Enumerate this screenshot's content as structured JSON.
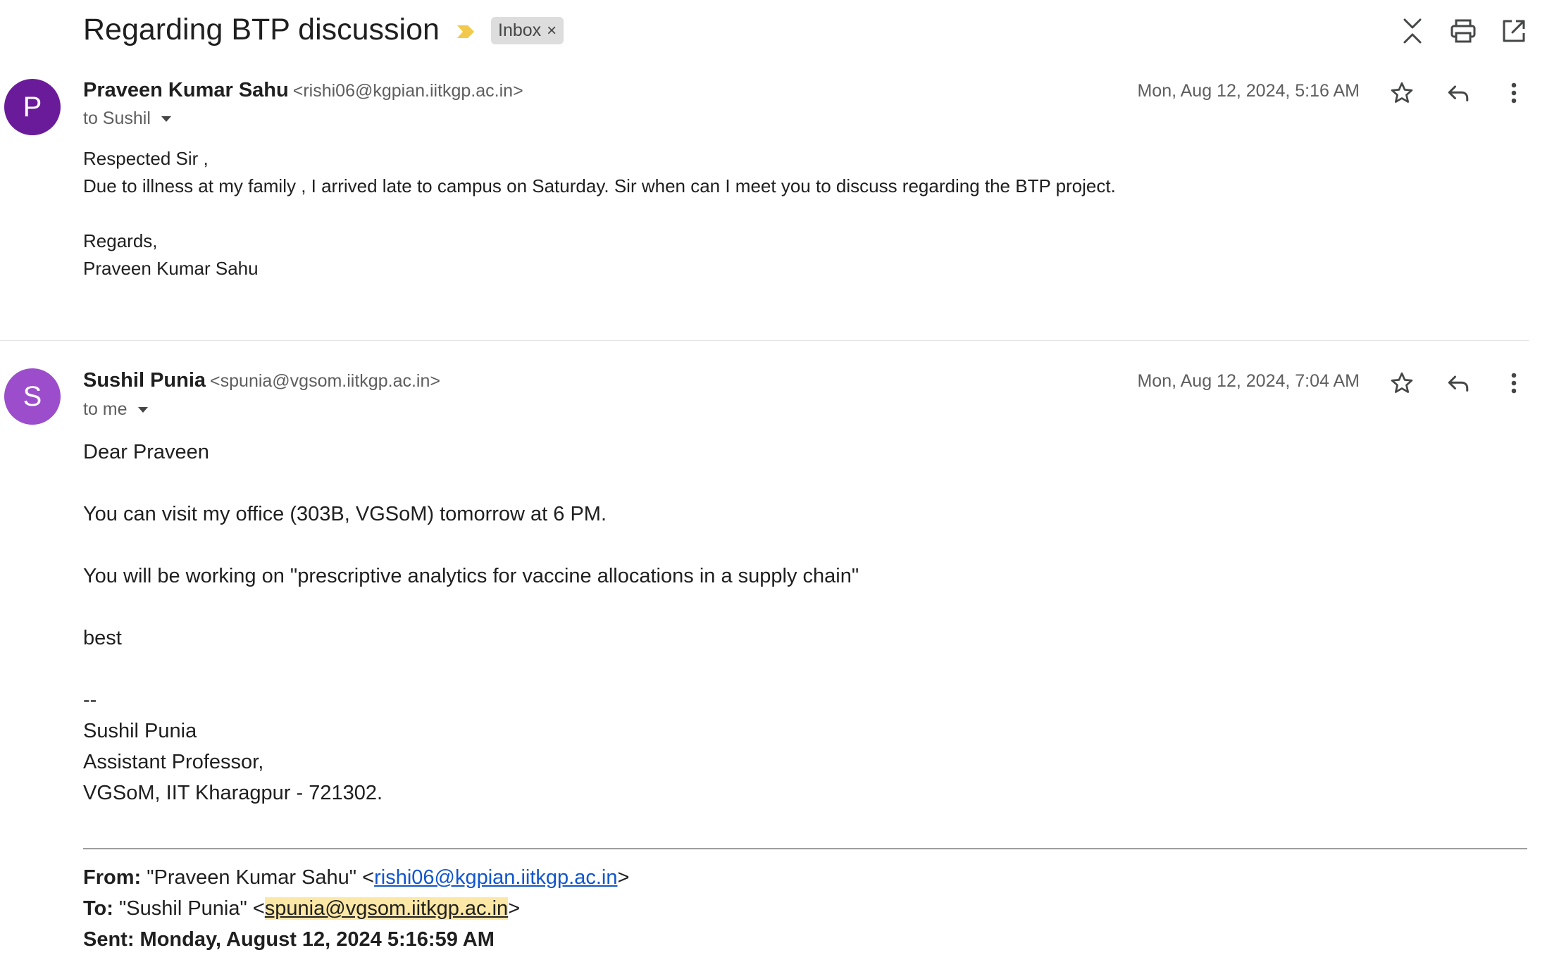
{
  "thread": {
    "subject": "Regarding BTP discussion",
    "label": "Inbox",
    "label_remove": "×"
  },
  "toolbar": {
    "icons": [
      "collapse-all-icon",
      "print-icon",
      "open-in-new-window-icon"
    ]
  },
  "messages": [
    {
      "avatar_letter": "P",
      "avatar_color": "#6a1b9a",
      "sender_name": "Praveen Kumar Sahu",
      "sender_email": "<rishi06@kgpian.iitkgp.ac.in>",
      "recipients": "to Sushil",
      "date": "Mon, Aug 12, 2024, 5:16 AM",
      "body": [
        "Respected Sir ,",
        "Due to illness at my family , I arrived late to campus on Saturday. Sir when can I meet you to discuss regarding the BTP project.",
        "",
        "Regards,",
        "Praveen Kumar Sahu"
      ]
    },
    {
      "avatar_letter": "S",
      "avatar_color": "#9c4dcc",
      "sender_name": "Sushil Punia",
      "sender_email": "<spunia@vgsom.iitkgp.ac.in>",
      "recipients": "to me",
      "date": "Mon, Aug 12, 2024, 7:04 AM",
      "body": [
        "Dear Praveen",
        "You can visit my office (303B, VGSoM) tomorrow at 6 PM.",
        "You will be working on \"prescriptive analytics for vaccine allocations in a supply chain\"",
        "best",
        "--",
        "Sushil Punia",
        "Assistant Professor,",
        "VGSoM, IIT Kharagpur - 721302."
      ],
      "quoted": {
        "from_label": "From:",
        "from_name": "\"Praveen Kumar Sahu\" <",
        "from_email": "rishi06@kgpian.iitkgp.ac.in",
        "from_close": ">",
        "to_label": "To:",
        "to_name": "\"Sushil Punia\" <",
        "to_email": "spunia@vgsom.iitkgp.ac.in",
        "to_close": ">",
        "sent_partial": "Sent: Monday, August 12, 2024 5:16:59 AM"
      }
    }
  ]
}
